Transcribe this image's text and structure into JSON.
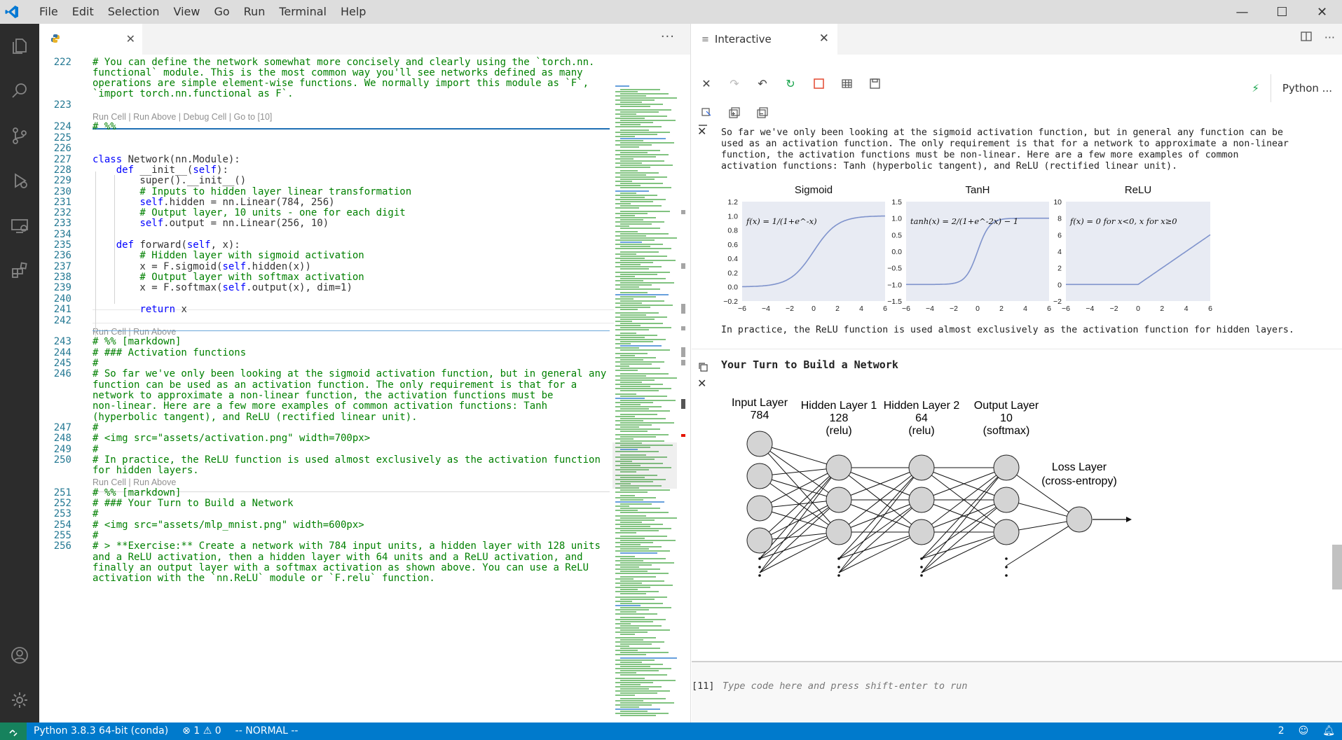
{
  "menu": [
    "File",
    "Edit",
    "Selection",
    "View",
    "Go",
    "Run",
    "Terminal",
    "Help"
  ],
  "window_controls": {
    "minimize": "—",
    "maximize": "☐",
    "close": "✕"
  },
  "editor": {
    "tab_close": "✕",
    "more": "···",
    "codelens": {
      "first": "Run Cell | Run Above | Debug Cell | Go to [10]",
      "second": "Run Cell | Run Above",
      "third": "Run Cell | Run Above"
    }
  },
  "code_lines": [
    {
      "n": "222",
      "t": "# You can define the network somewhat more concisely and clearly using the `torch.nn."
    },
    {
      "n": "",
      "t": "functional` module. This is the most common way you'll see networks defined as many"
    },
    {
      "n": "",
      "t": "operations are simple element-wise functions. We normally import this module as `F`,"
    },
    {
      "n": "",
      "t": "`import torch.nn.functional as F`."
    },
    {
      "n": "223",
      "t": ""
    },
    {
      "n": "224",
      "t": "# %%"
    },
    {
      "n": "225",
      "t": ""
    },
    {
      "n": "226",
      "t": ""
    },
    {
      "n": "227",
      "t": "class Network(nn.Module):"
    },
    {
      "n": "228",
      "t": "    def __init__(self):"
    },
    {
      "n": "229",
      "t": "        super().__init__()"
    },
    {
      "n": "230",
      "t": "        # Inputs to hidden layer linear transformation"
    },
    {
      "n": "231",
      "t": "        self.hidden = nn.Linear(784, 256)"
    },
    {
      "n": "232",
      "t": "        # Output layer, 10 units - one for each digit"
    },
    {
      "n": "233",
      "t": "        self.output = nn.Linear(256, 10)"
    },
    {
      "n": "234",
      "t": ""
    },
    {
      "n": "235",
      "t": "    def forward(self, x):"
    },
    {
      "n": "236",
      "t": "        # Hidden layer with sigmoid activation"
    },
    {
      "n": "237",
      "t": "        x = F.sigmoid(self.hidden(x))"
    },
    {
      "n": "238",
      "t": "        # Output layer with softmax activation"
    },
    {
      "n": "239",
      "t": "        x = F.softmax(self.output(x), dim=1)"
    },
    {
      "n": "240",
      "t": ""
    },
    {
      "n": "241",
      "t": "        return x"
    },
    {
      "n": "242",
      "t": ""
    },
    {
      "n": "243",
      "t": "# %% [markdown]"
    },
    {
      "n": "244",
      "t": "# ### Activation functions"
    },
    {
      "n": "245",
      "t": "#"
    },
    {
      "n": "246",
      "t": "# So far we've only been looking at the sigmoid activation function, but in general any"
    },
    {
      "n": "",
      "t": "function can be used as an activation function. The only requirement is that for a"
    },
    {
      "n": "",
      "t": "network to approximate a non-linear function, the activation functions must be"
    },
    {
      "n": "",
      "t": "non-linear. Here are a few more examples of common activation functions: Tanh"
    },
    {
      "n": "",
      "t": "(hyperbolic tangent), and ReLU (rectified linear unit)."
    },
    {
      "n": "247",
      "t": "#"
    },
    {
      "n": "248",
      "t": "# <img src=\"assets/activation.png\" width=700px>"
    },
    {
      "n": "249",
      "t": "#"
    },
    {
      "n": "250",
      "t": "# In practice, the ReLU function is used almost exclusively as the activation function"
    },
    {
      "n": "",
      "t": "for hidden layers."
    },
    {
      "n": "251",
      "t": "# %% [markdown]"
    },
    {
      "n": "252",
      "t": "# ### Your Turn to Build a Network"
    },
    {
      "n": "253",
      "t": "#"
    },
    {
      "n": "254",
      "t": "# <img src=\"assets/mlp_mnist.png\" width=600px>"
    },
    {
      "n": "255",
      "t": "#"
    },
    {
      "n": "256",
      "t": "# > **Exercise:** Create a network with 784 input units, a hidden layer with 128 units"
    },
    {
      "n": "",
      "t": "and a ReLU activation, then a hidden layer with 64 units and a ReLU activation, and"
    },
    {
      "n": "",
      "t": "finally an output layer with a softmax activation as shown above. You can use a ReLU"
    },
    {
      "n": "",
      "t": "activation with the `nn.ReLU` module or `F.relu` function."
    }
  ],
  "interactive": {
    "tab_label": "Interactive",
    "tab_close": "✕",
    "kernel_label": "Python ...",
    "md1": "So far we've only been looking at the sigmoid activation function, but in general any function can be\nused as an activation function. The only requirement is that for a network to approximate a non-linear\nfunction, the activation functions must be non-linear. Here are a few more examples of common\nactivation functions: Tanh (hyperbolic tangent), and ReLU (rectified linear unit).",
    "md2": "In practice, the ReLU function is used almost exclusively as the activation function for hidden layers.",
    "heading": "Your Turn to Build a Network",
    "prompt": "[11]",
    "input_placeholder": "Type code here and press shift-enter to run"
  },
  "activation_plots": [
    {
      "title": "Sigmoid",
      "formula": "f(x) = 1/(1+e^-x)",
      "yticks": [
        "1.2",
        "1.0",
        "0.8",
        "0.6",
        "0.4",
        "0.2",
        "0.0",
        "−0.2"
      ],
      "xticks": [
        "−6",
        "−4",
        "−2",
        "0",
        "2",
        "4",
        "6"
      ]
    },
    {
      "title": "TanH",
      "formula": "tanh(x) = 2/(1+e^-2x) − 1",
      "yticks": [
        "1.5",
        "1.0",
        "0.5",
        "0.0",
        "−0.5",
        "−1.0",
        "−1.5"
      ],
      "xticks": [
        "−6",
        "−4",
        "−2",
        "0",
        "2",
        "4",
        "6"
      ]
    },
    {
      "title": "ReLU",
      "formula": "f(x) = 0 for x<0, x for x≥0",
      "yticks": [
        "10",
        "8",
        "6",
        "4",
        "2",
        "0",
        "−2"
      ],
      "xticks": [
        "−6",
        "−4",
        "−2",
        "0",
        "2",
        "4",
        "6"
      ]
    }
  ],
  "network_diagram": {
    "layers": [
      {
        "name": "Input Layer",
        "size": "784",
        "act": ""
      },
      {
        "name": "Hidden Layer 1",
        "size": "128",
        "act": "(relu)"
      },
      {
        "name": "Hidden Layer 2",
        "size": "64",
        "act": "(relu)"
      },
      {
        "name": "Output Layer",
        "size": "10",
        "act": "(softmax)"
      }
    ],
    "loss": {
      "name": "Loss Layer",
      "sub": "(cross-entropy)"
    }
  },
  "status": {
    "interpreter": "Python 3.8.3 64-bit (conda)",
    "errors": "1",
    "warnings": "0",
    "mode": "-- NORMAL --",
    "right_count": "2"
  },
  "colors": {
    "accent": "#007acc",
    "activity_bg": "#2c2c2c",
    "comment": "#008000",
    "keyword": "#0000ff"
  }
}
